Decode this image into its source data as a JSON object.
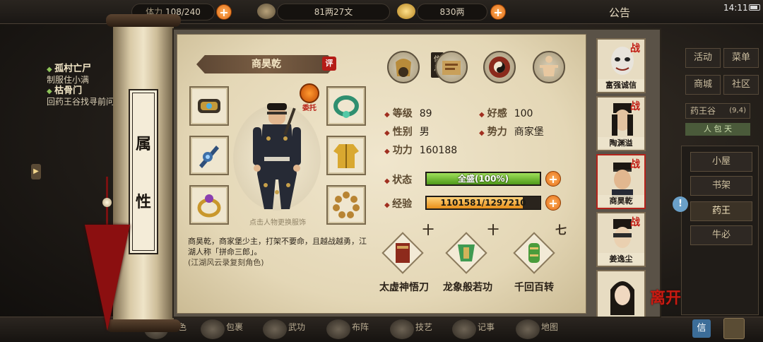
{
  "topbar": {
    "res1_label": "体力",
    "res1_value": "108/240",
    "res2_value": "81两27文",
    "res3_value": "830两",
    "notice": "公告",
    "time": "14:11"
  },
  "quests": [
    {
      "title": "孤村亡尸",
      "desc": "制服住小满"
    },
    {
      "title": "枯骨门",
      "desc": "回药王谷找寻前问结果"
    }
  ],
  "side_menu": {
    "buttons": [
      "活动",
      "菜单",
      "商城",
      "社区"
    ],
    "location": "药王谷",
    "coords": "(9,4)",
    "tab": "人 包 天",
    "places": [
      "小屋",
      "书架",
      "药王",
      "牛必"
    ]
  },
  "scroll": {
    "chars": [
      "属",
      "性"
    ]
  },
  "character": {
    "name": "商昊乾",
    "rate_badge": "评",
    "entrust": "委托",
    "hint": "点击人物更换服饰",
    "bio_line1": "商昊乾，商家堡少主，打架不要命，且越战越勇，江湖人称「拼命三郎」。",
    "bio_line2": "(江湖风云录复刻角色)"
  },
  "tabs": {
    "info": "信息"
  },
  "stats": {
    "level_label": "等级",
    "level": "89",
    "favor_label": "好感",
    "favor": "100",
    "gender_label": "性别",
    "gender": "男",
    "faction_label": "势力",
    "faction": "商家堡",
    "power_label": "功力",
    "power": "160188",
    "status_label": "状态",
    "status": "全盛(100%)",
    "status_fill": 1.0,
    "exp_label": "经验",
    "exp": "1101581/1297210",
    "exp_fill": 0.849
  },
  "skills": [
    {
      "name": "太虚神悟刀",
      "rank": "十"
    },
    {
      "name": "龙象般若功",
      "rank": "十"
    },
    {
      "name": "千回百转",
      "rank": "七"
    }
  ],
  "party": [
    {
      "name": "富强诚信",
      "tag": "战"
    },
    {
      "name": "陶渊溢",
      "tag": "战"
    },
    {
      "name": "商昊乾",
      "tag": "战"
    },
    {
      "name": "姜逸尘",
      "tag": "战"
    },
    {
      "name": "",
      "tag": ""
    }
  ],
  "leave": "离开",
  "bottom_nav": [
    "角色",
    "包裹",
    "武功",
    "布阵",
    "技艺",
    "记事",
    "地图"
  ],
  "bottom_msg": "信",
  "colors": {
    "status_bar": "#6fbf2a",
    "exp_bar": "#f1a521",
    "accent_red": "#b51c17",
    "plus_orange": "#e36b12"
  },
  "icons": [
    "gold-coin-icon",
    "silver-ingot-icon",
    "plus-icon",
    "gauntlet-icon",
    "necklace-icon",
    "sword-icon",
    "robe-icon",
    "ring-icon",
    "beads-icon",
    "info-bag-icon",
    "book-scroll-icon",
    "taiji-disc-icon",
    "body-meridian-icon"
  ]
}
